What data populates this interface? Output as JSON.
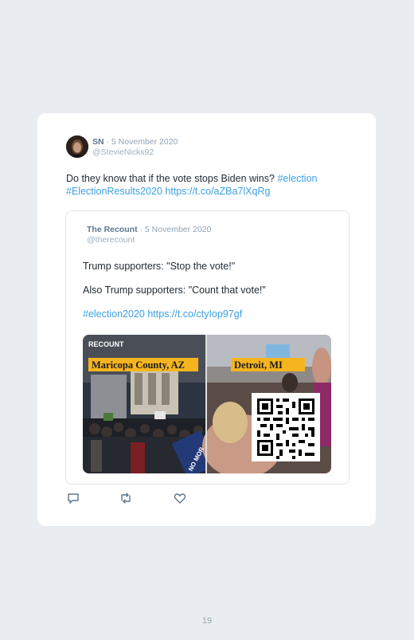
{
  "tweet": {
    "name": "SN",
    "date": "· 5 November 2020",
    "handle": "@StevieNicks92",
    "text_before": "Do they know that if the vote stops Biden wins? ",
    "hashtag1": "#election",
    "hashtag2": "#ElectionResults2020",
    "link": "https://t.co/aZBa7lXqRg"
  },
  "quote": {
    "name": "The Recount",
    "date": "· 5 November 2020",
    "handle": "@therecount",
    "line1": "Trump supporters: \"Stop the vote!\"",
    "line2": "Also Trump supporters: \"Count that vote!\"",
    "hashtag": "#election2020",
    "link": "https://t.co/ctyIop97gf",
    "media": {
      "brand": "RECOUNT",
      "left_label": "Maricopa County, AZ",
      "right_label": "Detroit, MI",
      "sign_text": "NO MOR"
    }
  },
  "page": {
    "number": "19"
  },
  "icons": [
    "reply-icon",
    "retweet-icon",
    "like-icon",
    "qr-code-icon"
  ],
  "colors": {
    "link": "#3ba1e3",
    "label_bg": "#f6b51e",
    "background": "#e9edf1"
  }
}
